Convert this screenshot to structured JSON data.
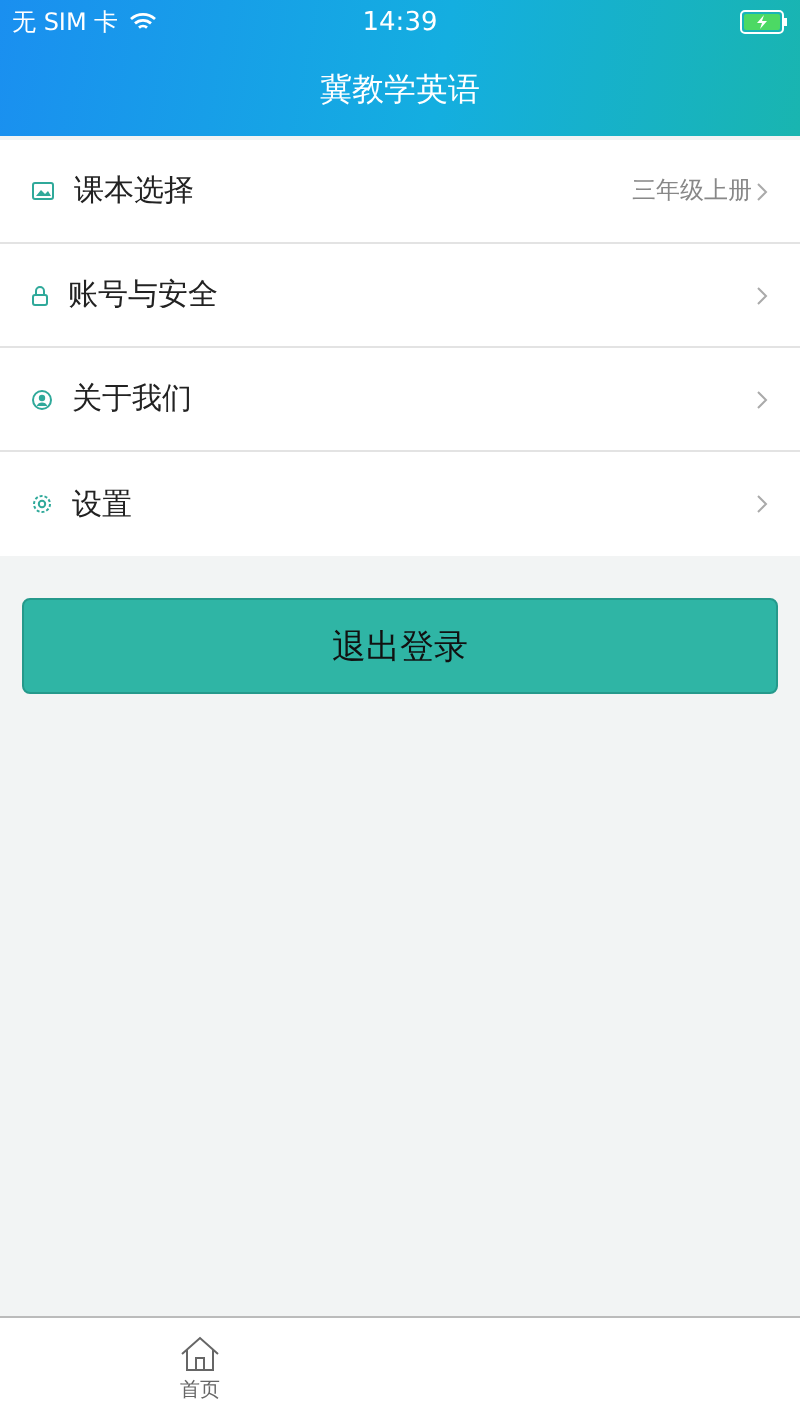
{
  "status_bar": {
    "carrier": "无 SIM 卡",
    "time": "14:39",
    "charging": true
  },
  "nav_bar": {
    "title": "冀教学英语"
  },
  "menu": [
    {
      "kind": "book",
      "label": "课本选择",
      "value": "三年级上册"
    },
    {
      "kind": "lock",
      "label": "账号与安全"
    },
    {
      "kind": "person",
      "label": "关于我们"
    },
    {
      "kind": "gear",
      "label": "设置"
    }
  ],
  "logout_button": "退出登录",
  "tab_bar": [
    {
      "kind": "home",
      "label": "首页",
      "selected": false
    }
  ]
}
